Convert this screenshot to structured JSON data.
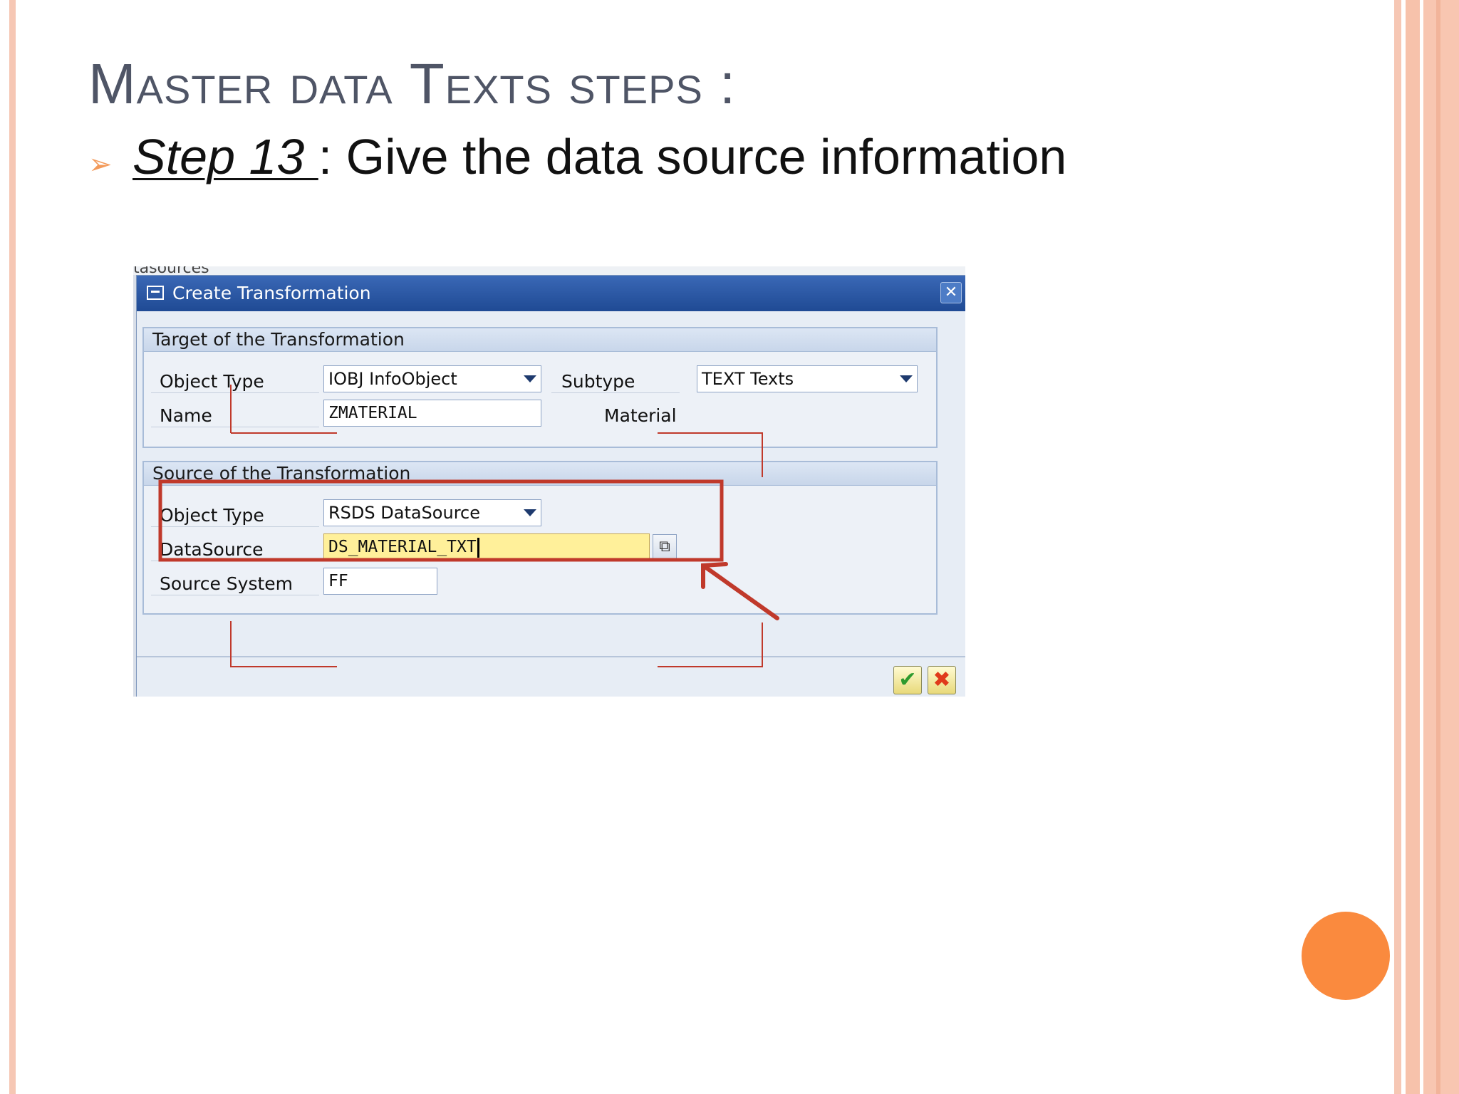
{
  "slide": {
    "title_initial_1": "M",
    "title_rest_1": "aster data ",
    "title_initial_2": "T",
    "title_rest_2": "exts steps :",
    "step_label": "Step 13 ",
    "step_text": ": Give the data source information",
    "colors": {
      "accent": "#fa8a3e",
      "edge": "#f6c7b4",
      "title": "#4f5566",
      "annotation_red": "#c0392b"
    }
  },
  "screenshot": {
    "background_text": "tasources",
    "dialog": {
      "title": "Create Transformation",
      "close_icon": "close-icon",
      "target_group": {
        "header": "Target of the Transformation",
        "object_type_label": "Object Type",
        "object_type_value": "IOBJ InfoObject",
        "subtype_label": "Subtype",
        "subtype_value": "TEXT Texts",
        "name_label": "Name",
        "name_value": "ZMATERIAL",
        "name_description": "Material"
      },
      "source_group": {
        "header": "Source of the Transformation",
        "object_type_label": "Object Type",
        "object_type_value": "RSDS DataSource",
        "datasource_label": "DataSource",
        "datasource_value": "DS_MATERIAL_TXT",
        "source_system_label": "Source System",
        "source_system_value": "FF"
      },
      "buttons": {
        "ok_icon": "checkmark-icon",
        "ok_glyph": "✔",
        "cancel_icon": "cancel-x-icon",
        "cancel_glyph": "✖"
      }
    }
  }
}
